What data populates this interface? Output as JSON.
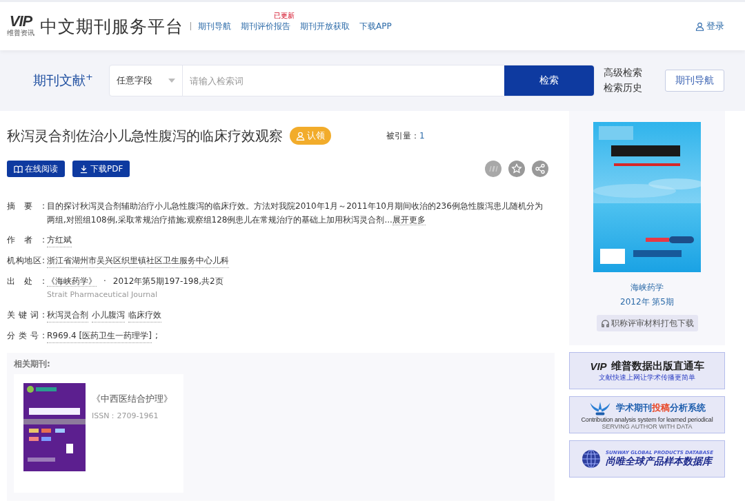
{
  "header": {
    "logo": "VIP",
    "logo_caption": "维普资讯",
    "site_title": "中文期刊服务平台",
    "nav": [
      {
        "label": "期刊导航"
      },
      {
        "label": "期刊评价报告",
        "badge": "已更新"
      },
      {
        "label": "期刊开放获取"
      },
      {
        "label": "下载APP"
      }
    ],
    "login": "登录"
  },
  "search": {
    "scope": "期刊文献",
    "scope_mark": "+",
    "field": "任意字段",
    "placeholder": "请输入检索词",
    "button": "检索",
    "links": [
      "高级检索",
      "检索历史"
    ],
    "nav_button": "期刊导航"
  },
  "article": {
    "title": "秋泻灵合剂佐治小儿急性腹泻的临床疗效观察",
    "claim": "认领",
    "cited_label": "被引量：",
    "cited": "1",
    "actions": [
      {
        "label": "在线阅读",
        "kind": "read"
      },
      {
        "label": "下载PDF",
        "kind": "download"
      }
    ],
    "meta": [
      {
        "label": "摘要:",
        "kind": "abstract",
        "text": "目的探讨秋泻灵合剂辅助治疗小儿急性腹泻的临床疗效。方法对我院2010年1月～2011年10月期间收治的236例急性腹泻患儿随机分为两组,对照组108例,采取常规治疗措施;观察组128例患儿在常规治疗的基础上加用秋泻灵合剂...",
        "more": "展开更多"
      },
      {
        "label": "作者:",
        "kind": "links",
        "links": [
          "方红斌"
        ]
      },
      {
        "label": "机构地区:",
        "kind": "links",
        "links": [
          "浙江省湖州市吴兴区织里镇社区卫生服务中心儿科"
        ]
      },
      {
        "label": "出处:",
        "kind": "source",
        "journal": "《海峡药学》",
        "separator": "·",
        "issue": "2012年第5期197-198,共2页",
        "english": "Strait Pharmaceutical Journal"
      },
      {
        "label": "关键词:",
        "kind": "links",
        "links": [
          "秋泻灵合剂",
          "小儿腹泻",
          "临床疗效"
        ]
      },
      {
        "label": "分类号:",
        "kind": "links",
        "links": [
          "R969.4 [医药卫生一药理学]"
        ],
        "suffix": ";"
      }
    ]
  },
  "related": {
    "heading": "相关期刊:",
    "journals": [
      {
        "title": "《中西医结合护理》",
        "issn": "ISSN：2709-1961"
      }
    ]
  },
  "sidebar": {
    "journal": "海峡药学",
    "issue": "2012年 第5期",
    "download": "职称评审材料打包下载",
    "banners": [
      {
        "kind": "vip",
        "logo": "VIP",
        "title": "维普数据出版直通车",
        "subtitle": "文献快速上网让学术传播更简单"
      },
      {
        "kind": "submit",
        "title_parts": [
          {
            "text": "学术期刊",
            "highlight": false
          },
          {
            "text": "投稿",
            "highlight": true
          },
          {
            "text": "分析系统",
            "highlight": false
          }
        ],
        "subtitle": "Contribution analysis system for learned periodical",
        "tagline": "SERVING AUTHOR WITH DATA"
      },
      {
        "kind": "sunway",
        "subtitle": "SUNWAY GLOBAL PRODUCTS DATABASE",
        "title": "尚唯全球产品样本数据库"
      }
    ]
  }
}
